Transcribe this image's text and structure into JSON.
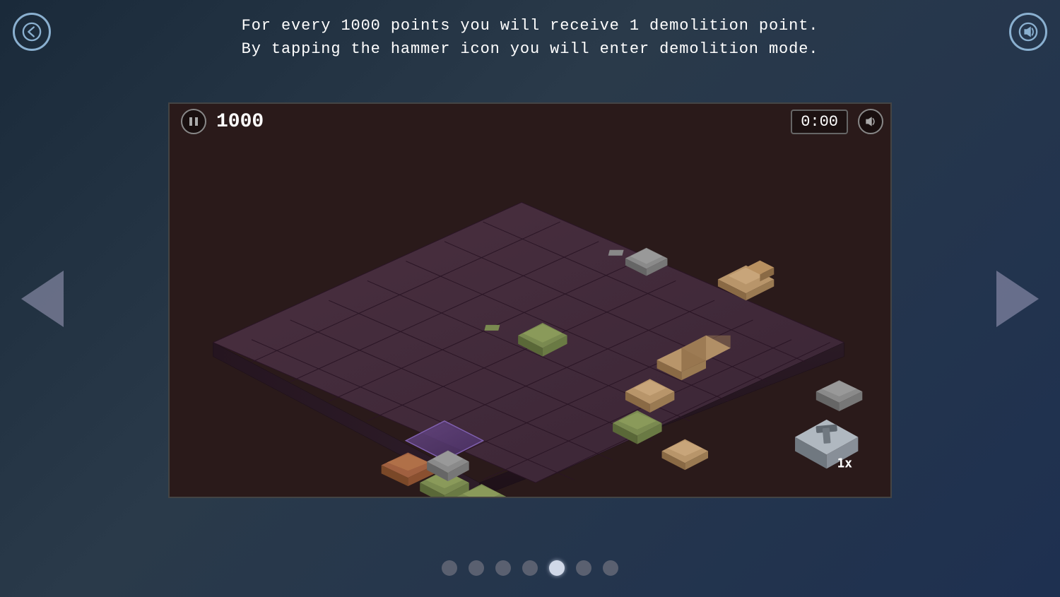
{
  "page": {
    "background": "#1e2d3d",
    "instruction_line1": "For every 1000 points you will receive 1 demolition point.",
    "instruction_line2": "By tapping the hammer icon you will enter demolition mode."
  },
  "hud": {
    "score": "1000",
    "timer": "0:00",
    "pause_label": "pause",
    "sound_label": "sound"
  },
  "navigation": {
    "back_label": "back",
    "left_arrow_label": "previous",
    "right_arrow_label": "next"
  },
  "hammer": {
    "count": "1x"
  },
  "pagination": {
    "total": 7,
    "active": 5
  }
}
